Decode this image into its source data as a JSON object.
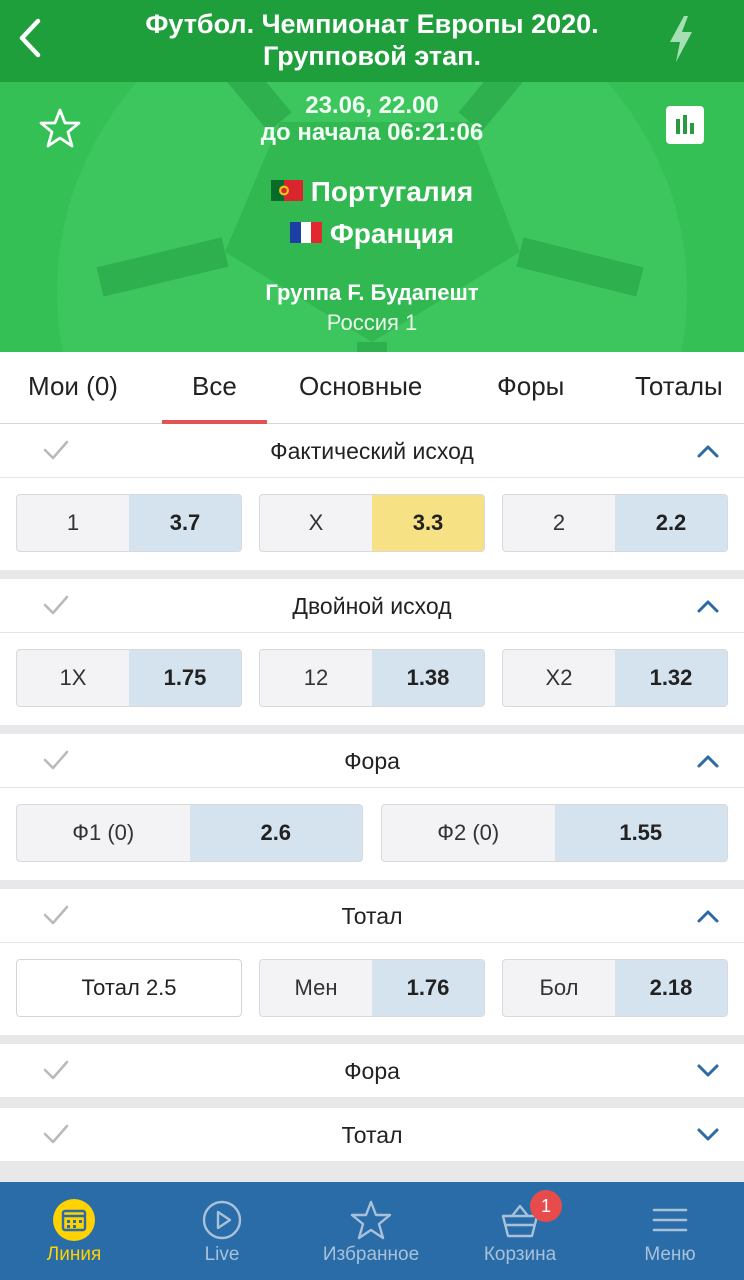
{
  "topbar": {
    "title_line1": "Футбол. Чемпионат Европы 2020.",
    "title_line2": "Групповой этап."
  },
  "match": {
    "date": "23.06, 22.00",
    "countdown": "до начала 06:21:06",
    "team1": "Португалия",
    "team2": "Франция",
    "group": "Группа F. Будапешт",
    "channel": "Россия 1"
  },
  "tabs": [
    {
      "label": "Мои (0)"
    },
    {
      "label": "Все"
    },
    {
      "label": "Основные"
    },
    {
      "label": "Форы"
    },
    {
      "label": "Тоталы"
    }
  ],
  "markets": {
    "outcome": {
      "title": "Фактический исход",
      "bets": [
        {
          "label": "1",
          "odd": "3.7"
        },
        {
          "label": "X",
          "odd": "3.3"
        },
        {
          "label": "2",
          "odd": "2.2"
        }
      ]
    },
    "double": {
      "title": "Двойной исход",
      "bets": [
        {
          "label": "1X",
          "odd": "1.75"
        },
        {
          "label": "12",
          "odd": "1.38"
        },
        {
          "label": "X2",
          "odd": "1.32"
        }
      ]
    },
    "handicap": {
      "title": "Фора",
      "bets": [
        {
          "label": "Ф1 (0)",
          "odd": "2.6"
        },
        {
          "label": "Ф2 (0)",
          "odd": "1.55"
        }
      ]
    },
    "total": {
      "title": "Тотал",
      "line": "Тотал 2.5",
      "bets": [
        {
          "label": "Мен",
          "odd": "1.76"
        },
        {
          "label": "Бол",
          "odd": "2.18"
        }
      ]
    },
    "handicap2": {
      "title": "Фора"
    },
    "total2": {
      "title": "Тотал"
    }
  },
  "nav": [
    {
      "label": "Линия",
      "icon": "calendar-icon"
    },
    {
      "label": "Live",
      "icon": "play-icon"
    },
    {
      "label": "Избранное",
      "icon": "star-icon"
    },
    {
      "label": "Корзина",
      "icon": "basket-icon",
      "badge": "1"
    },
    {
      "label": "Меню",
      "icon": "menu-icon"
    }
  ],
  "colors": {
    "topbar": "#1f9f3c",
    "header": "#34c055",
    "highlight_odd": "#f6e185",
    "odd_bg": "#d4e3ee",
    "nav_bg": "#2a6ca8",
    "nav_active": "#ffd200",
    "tab_indicator": "#e25454"
  }
}
